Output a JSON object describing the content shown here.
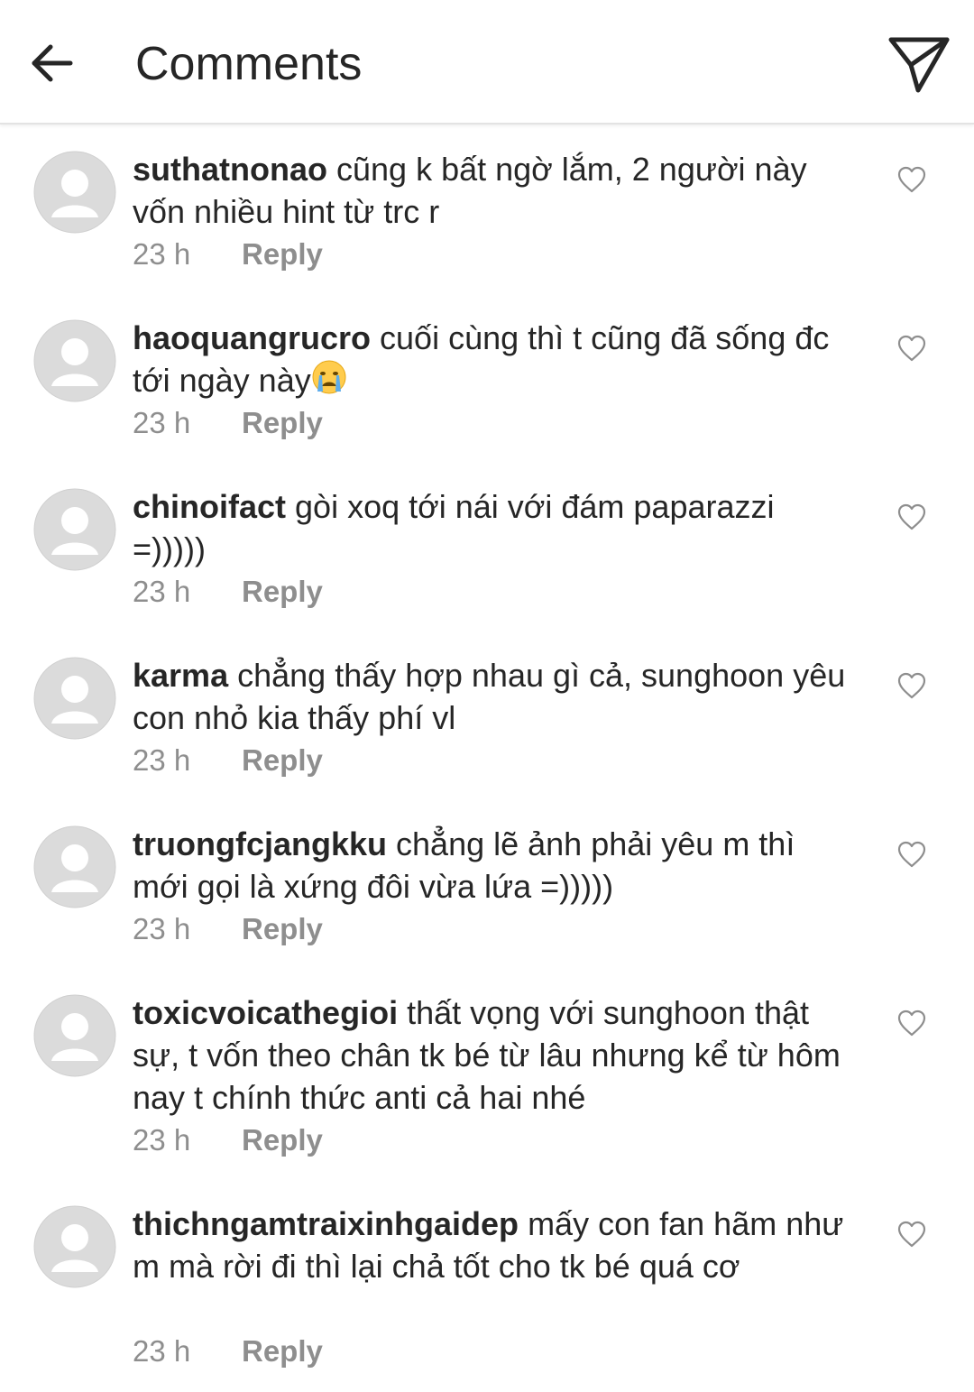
{
  "header": {
    "title": "Comments",
    "back_icon": "arrow-left-icon",
    "send_icon": "paper-plane-icon"
  },
  "colors": {
    "text": "#262626",
    "secondary": "#8e8e8e",
    "avatar_bg": "#dbdbdb",
    "heart": "#8e8e8e"
  },
  "comments": [
    {
      "username": "suthatnonao",
      "text": "cũng k bất ngờ lắm, 2 người này vốn nhiều hint từ trc r",
      "time": "23 h",
      "reply_label": "Reply"
    },
    {
      "username": "haoquangrucro",
      "text": "cuối cùng thì t cũng đã sống đc tới ngày này",
      "emoji": "crying-face-icon",
      "time": "23 h",
      "reply_label": "Reply"
    },
    {
      "username": "chinoifact",
      "text": "gòi xoq tới nái với đám paparazzi =)))))",
      "time": "23 h",
      "reply_label": "Reply"
    },
    {
      "username": "karma",
      "text": "chẳng thấy hợp nhau gì cả, sunghoon yêu con nhỏ kia thấy phí vl",
      "time": "23 h",
      "reply_label": "Reply"
    },
    {
      "username": "truongfcjangkku",
      "text": "chẳng lẽ ảnh phải yêu m thì mới gọi là xứng đôi vừa lứa =)))))",
      "time": "23 h",
      "reply_label": "Reply"
    },
    {
      "username": "toxicvoicathegioi",
      "text": "thất vọng với sunghoon thật sự, t vốn theo chân tk bé từ lâu nhưng kể từ hôm nay t chính thức anti cả hai nhé",
      "time": "23 h",
      "reply_label": "Reply"
    },
    {
      "username": "thichngamtraixinhgaidep",
      "text": "mấy con fan hãm như m mà rời đi thì lại chả tốt cho tk bé quá cơ",
      "time": "23 h",
      "reply_label": "Reply"
    }
  ]
}
